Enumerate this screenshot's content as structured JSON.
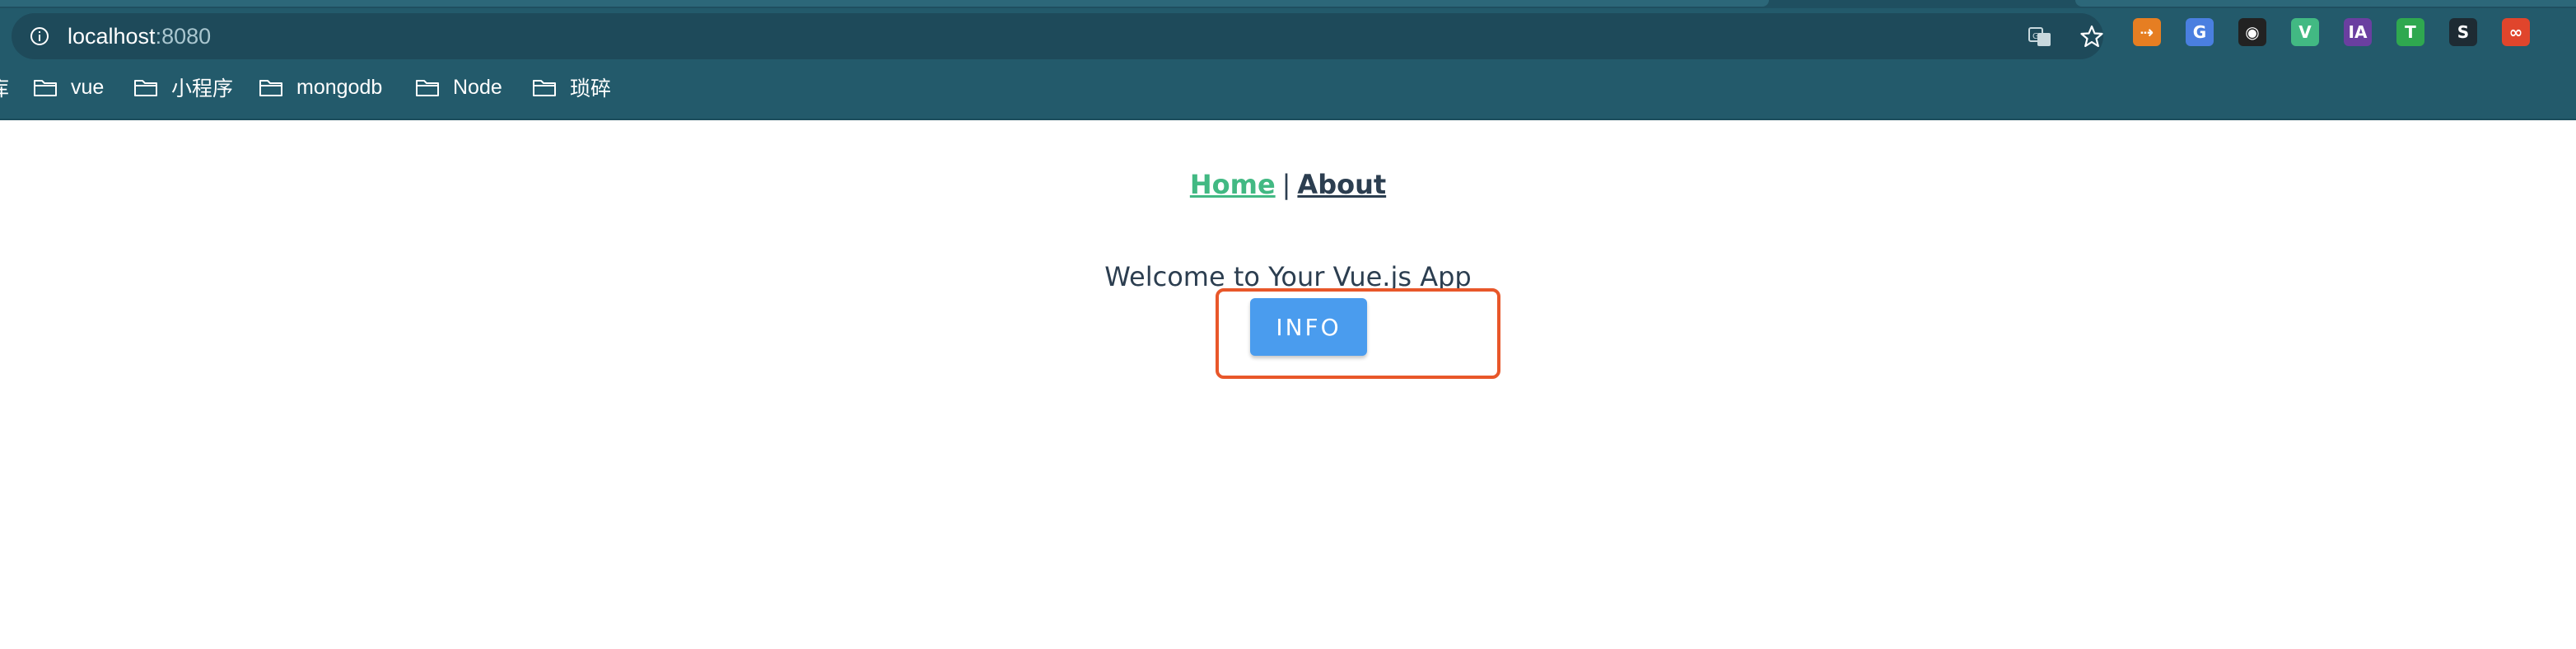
{
  "browser": {
    "url_host": "localhost",
    "url_port": ":8080",
    "bookmarks": [
      {
        "label": "库",
        "has_folder": false
      },
      {
        "label": "vue",
        "has_folder": true
      },
      {
        "label": "小程序",
        "has_folder": true
      },
      {
        "label": "mongodb",
        "has_folder": true
      },
      {
        "label": "Node",
        "has_folder": true
      },
      {
        "label": "琐碎",
        "has_folder": true
      }
    ],
    "extensions": [
      {
        "icon": "orange-arrow-extension-icon",
        "glyph": "⇢",
        "color": "#e67e22"
      },
      {
        "icon": "google-translate-extension-icon",
        "glyph": "G",
        "color": "#4a7fe0"
      },
      {
        "icon": "incognito-extension-icon",
        "glyph": "◉",
        "color": "#222222"
      },
      {
        "icon": "vue-devtools-extension-icon",
        "glyph": "V",
        "color": "#42b983"
      },
      {
        "icon": "ia-extension-icon",
        "glyph": "IA",
        "color": "#6a3fa0"
      },
      {
        "icon": "tampermonkey-shield-extension-icon",
        "glyph": "T",
        "color": "#2fa84f"
      },
      {
        "icon": "s-extension-icon",
        "glyph": "S",
        "color": "#1e2b33"
      },
      {
        "icon": "infinity-extension-icon",
        "glyph": "∞",
        "color": "#e0452c"
      }
    ],
    "colors": {
      "chrome_bg": "#235a6b",
      "omnibox_bg": "#1e4a5a"
    }
  },
  "app": {
    "nav": {
      "home_label": "Home",
      "separator": "|",
      "about_label": "About"
    },
    "welcome_text": "Welcome to Your Vue.js App",
    "info_button_label": "INFO",
    "colors": {
      "active_link": "#42b983",
      "text": "#2c3e50",
      "button": "#4a9cee",
      "highlight": "#e8572a"
    }
  }
}
